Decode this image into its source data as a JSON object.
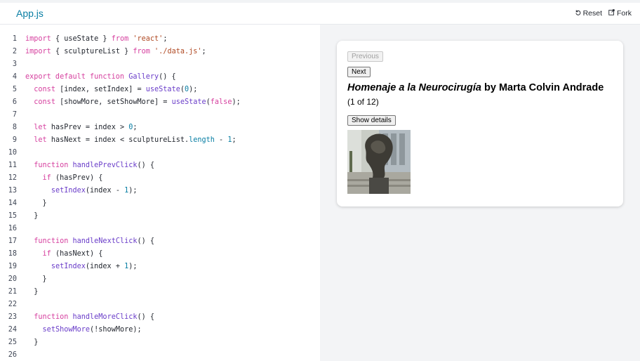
{
  "tabs": {
    "active_file": "App.js"
  },
  "toolbar": {
    "reset_label": "Reset",
    "fork_label": "Fork"
  },
  "editor": {
    "lines": [
      {
        "n": "1",
        "html": "<span class='kw'>import</span> { useState } <span class='kw'>from</span> <span class='str'>'react'</span>;"
      },
      {
        "n": "2",
        "html": "<span class='kw'>import</span> { sculptureList } <span class='kw'>from</span> <span class='str'>'./data.js'</span>;"
      },
      {
        "n": "3",
        "html": ""
      },
      {
        "n": "4",
        "html": "<span class='kw'>export default function</span> <span class='fn'>Gallery</span>() {"
      },
      {
        "n": "5",
        "html": "  <span class='kw'>const</span> [index, setIndex] = <span class='fn'>useState</span>(<span class='num'>0</span>);"
      },
      {
        "n": "6",
        "html": "  <span class='kw'>const</span> [showMore, setShowMore] = <span class='fn'>useState</span>(<span class='kw'>false</span>);"
      },
      {
        "n": "7",
        "html": ""
      },
      {
        "n": "8",
        "html": "  <span class='kw'>let</span> hasPrev = index &gt; <span class='num'>0</span>;"
      },
      {
        "n": "9",
        "html": "  <span class='kw'>let</span> hasNext = index &lt; sculptureList.<span class='prop'>length</span> - <span class='num'>1</span>;"
      },
      {
        "n": "10",
        "html": ""
      },
      {
        "n": "11",
        "html": "  <span class='kw'>function</span> <span class='fn'>handlePrevClick</span>() {"
      },
      {
        "n": "12",
        "html": "    <span class='kw'>if</span> (hasPrev) {"
      },
      {
        "n": "13",
        "html": "      <span class='fn'>setIndex</span>(index - <span class='num'>1</span>);"
      },
      {
        "n": "14",
        "html": "    }"
      },
      {
        "n": "15",
        "html": "  }"
      },
      {
        "n": "16",
        "html": ""
      },
      {
        "n": "17",
        "html": "  <span class='kw'>function</span> <span class='fn'>handleNextClick</span>() {"
      },
      {
        "n": "18",
        "html": "    <span class='kw'>if</span> (hasNext) {"
      },
      {
        "n": "19",
        "html": "      <span class='fn'>setIndex</span>(index + <span class='num'>1</span>);"
      },
      {
        "n": "20",
        "html": "    }"
      },
      {
        "n": "21",
        "html": "  }"
      },
      {
        "n": "22",
        "html": ""
      },
      {
        "n": "23",
        "html": "  <span class='kw'>function</span> <span class='fn'>handleMoreClick</span>() {"
      },
      {
        "n": "24",
        "html": "    <span class='fn'>setShowMore</span>(!showMore);"
      },
      {
        "n": "25",
        "html": "  }"
      },
      {
        "n": "26",
        "html": ""
      }
    ]
  },
  "preview": {
    "previous_label": "Previous",
    "next_label": "Next",
    "title_italic": "Homenaje a la Neurocirugía",
    "title_rest": " by Marta Colvin Andrade",
    "counter": "(1 of 12)",
    "show_details_label": "Show details",
    "image_alt": "sculpture photo"
  },
  "colors": {
    "accent": "#087ea4",
    "keyword": "#d6409f",
    "function": "#6a3dc9",
    "string": "#b04a24"
  },
  "icons": {
    "reset": "reset-icon",
    "fork": "fork-icon"
  }
}
